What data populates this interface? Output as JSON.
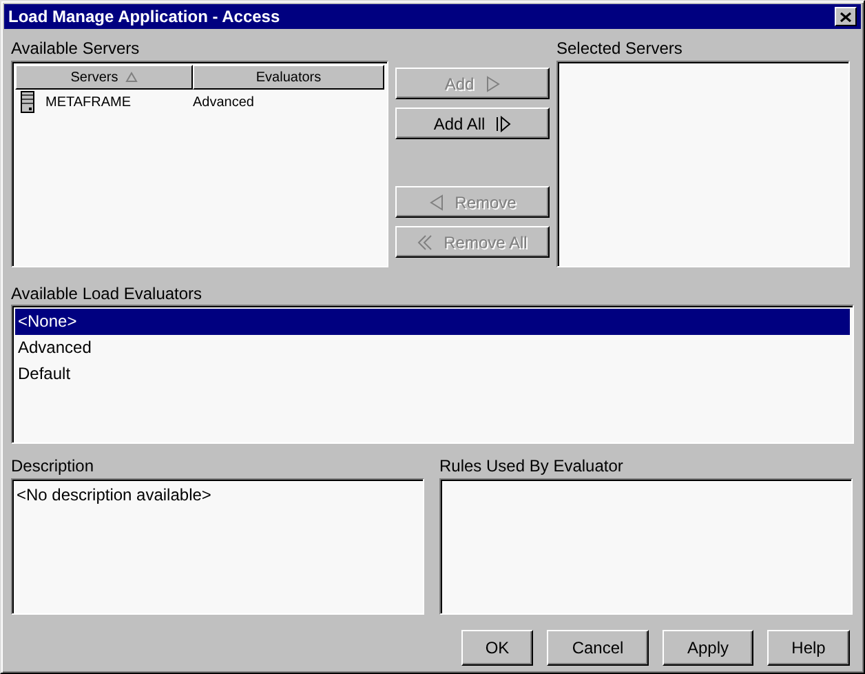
{
  "window": {
    "title": "Load Manage Application - Access"
  },
  "available_servers": {
    "label": "Available Servers",
    "columns": [
      {
        "label": "Servers",
        "sorted": true
      },
      {
        "label": "Evaluators",
        "sorted": false
      }
    ],
    "rows": [
      {
        "server": "METAFRAME",
        "evaluator": "Advanced"
      }
    ]
  },
  "transfer_buttons": [
    {
      "label": "Add",
      "kind": "add",
      "disabled": true
    },
    {
      "label": "Add All",
      "kind": "add-all",
      "disabled": false
    },
    {
      "label": "Remove",
      "kind": "remove",
      "disabled": true
    },
    {
      "label": "Remove All",
      "kind": "remove-all",
      "disabled": true
    }
  ],
  "selected_servers": {
    "label": "Selected Servers"
  },
  "load_evaluators": {
    "label": "Available Load Evaluators",
    "items": [
      {
        "label": "<None>",
        "selected": true
      },
      {
        "label": "Advanced",
        "selected": false
      },
      {
        "label": "Default",
        "selected": false
      }
    ]
  },
  "description": {
    "label": "Description",
    "text": "<No description available>"
  },
  "rules": {
    "label": "Rules Used By Evaluator"
  },
  "buttons": [
    "OK",
    "Cancel",
    "Apply",
    "Help"
  ]
}
